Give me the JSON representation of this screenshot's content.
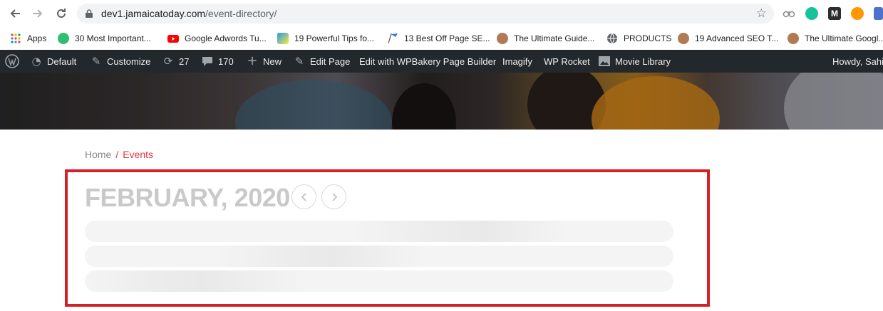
{
  "browser": {
    "url_host": "dev1.jamaicatoday.com",
    "url_path": "/event-directory/",
    "back_icon": "arrow-left-icon",
    "forward_icon": "arrow-right-icon",
    "reload_icon": "reload-icon",
    "star_icon": "star-icon"
  },
  "bookmarks": [
    {
      "label": "Apps",
      "icon": "apps-grid-icon",
      "color": "#e8453c"
    },
    {
      "label": "30 Most Important...",
      "icon": "site-favicon",
      "color": "#2fbf71"
    },
    {
      "label": "Google Adwords Tu...",
      "icon": "youtube-icon",
      "color": "#ff0000"
    },
    {
      "label": "19 Powerful Tips fo...",
      "icon": "site-favicon",
      "color": "#2196f3"
    },
    {
      "label": "13 Best Off Page SE...",
      "icon": "flag-icon",
      "color": "#3a7bd5"
    },
    {
      "label": "The Ultimate Guide...",
      "icon": "avatar-icon",
      "color": "#b07a55"
    },
    {
      "label": "PRODUCTS",
      "icon": "globe-icon",
      "color": "#5f6368"
    },
    {
      "label": "19 Advanced SEO T...",
      "icon": "avatar-icon",
      "color": "#b07a55"
    },
    {
      "label": "The Ultimate Googl...",
      "icon": "avatar-icon",
      "color": "#b07a55"
    }
  ],
  "adminbar": {
    "site": "Default",
    "customize": "Customize",
    "updates": "27",
    "comments": "170",
    "new": "New",
    "edit_page": "Edit Page",
    "wpbakery": "Edit with WPBakery Page Builder",
    "imagify": "Imagify",
    "wp_rocket": "WP Rocket",
    "movie_library": "Movie Library",
    "howdy": "Howdy, Sahi"
  },
  "breadcrumb": {
    "home": "Home",
    "separator": "/",
    "current": "Events"
  },
  "calendar": {
    "month_label": "FEBRUARY, 2020",
    "prev_icon": "chevron-left-icon",
    "next_icon": "chevron-right-icon"
  },
  "colors": {
    "accent": "#e0393e",
    "highlight_border": "#d61f26",
    "admin_bar": "#23282d"
  }
}
